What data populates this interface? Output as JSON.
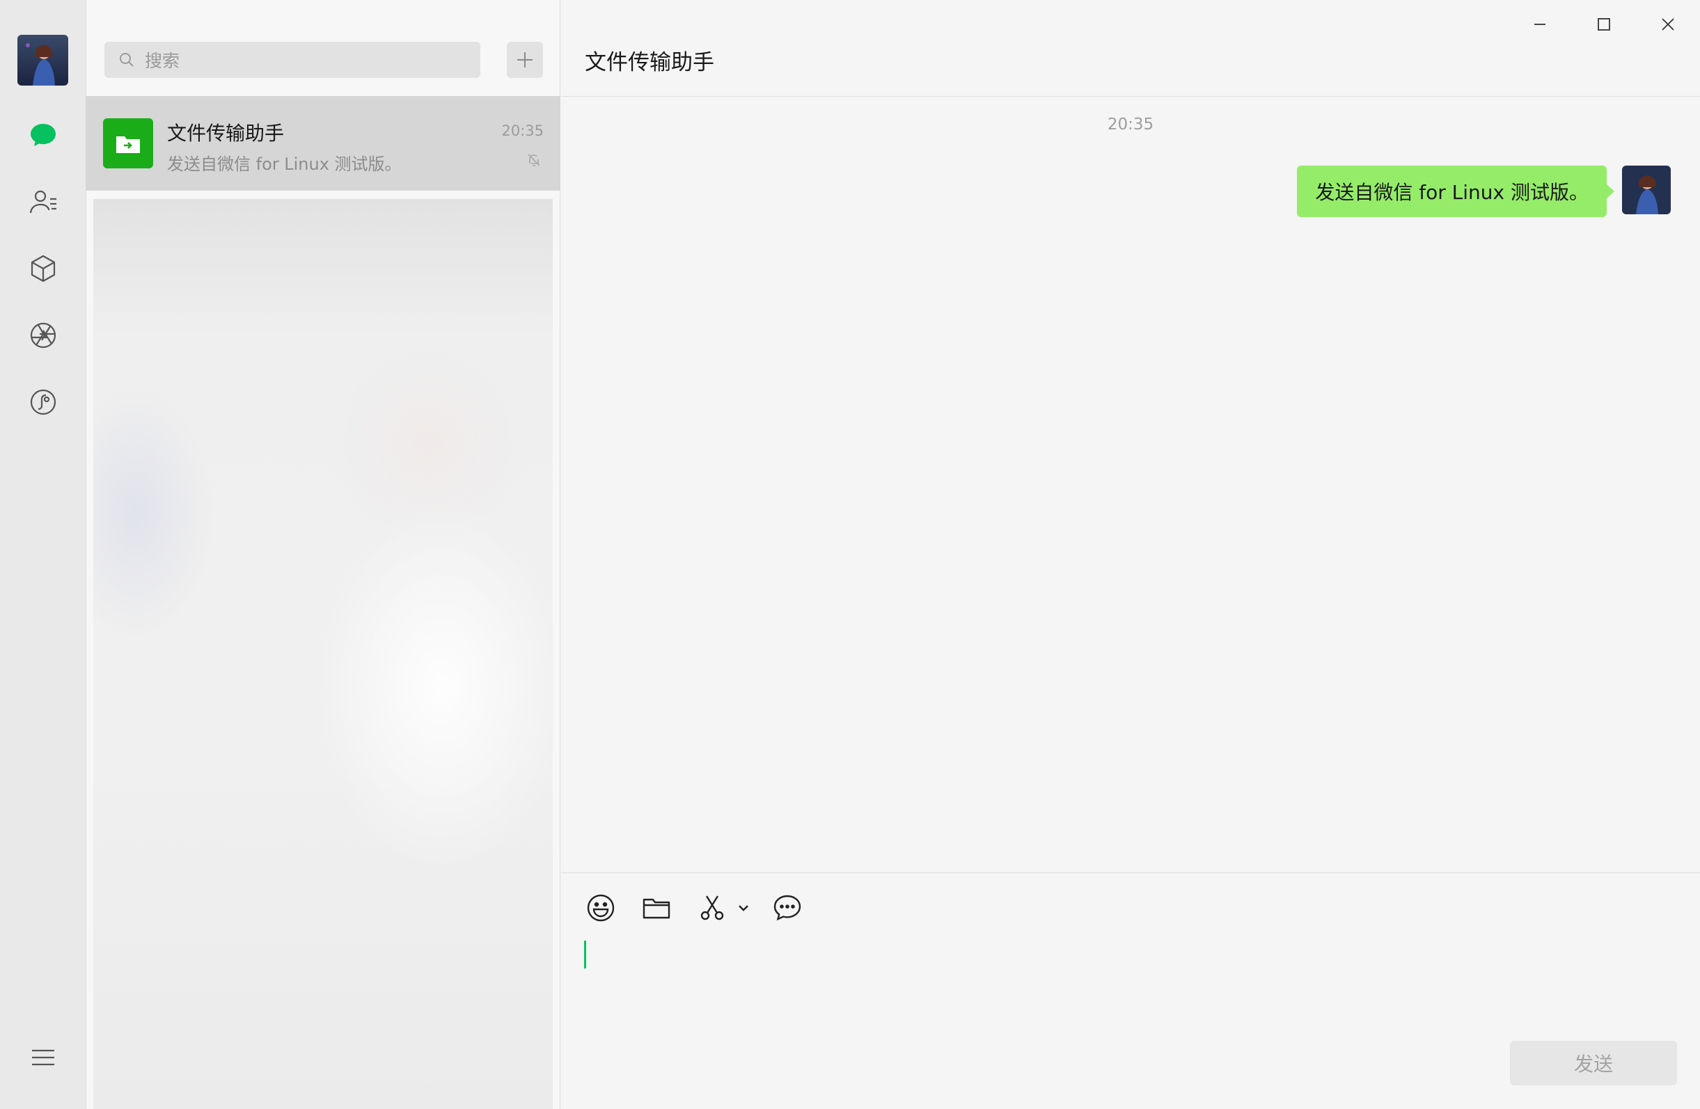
{
  "nav": {
    "items": [
      {
        "name": "chats",
        "icon": "chat-bubble-icon",
        "active": true
      },
      {
        "name": "contacts",
        "icon": "contacts-icon"
      },
      {
        "name": "favorites",
        "icon": "cube-icon"
      },
      {
        "name": "moments",
        "icon": "aperture-icon"
      },
      {
        "name": "channels",
        "icon": "channels-icon"
      }
    ],
    "menu_icon": "hamburger-menu-icon"
  },
  "search": {
    "placeholder": "搜索"
  },
  "chat_list": [
    {
      "name": "文件传输助手",
      "preview": "发送自微信 for Linux 测试版。",
      "time": "20:35",
      "muted": true,
      "selected": true
    }
  ],
  "chat": {
    "title": "文件传输助手",
    "messages": [
      {
        "time": "20:35",
        "text": "发送自微信 for Linux 测试版。",
        "from": "me"
      }
    ],
    "toolbar": [
      "emoji-icon",
      "folder-icon",
      "scissors-icon",
      "chevron-down-icon",
      "chat-history-icon"
    ],
    "send_label": "发送"
  },
  "colors": {
    "accent": "#07c160",
    "bubble_self": "#95ec69",
    "file_helper": "#1aad19"
  }
}
